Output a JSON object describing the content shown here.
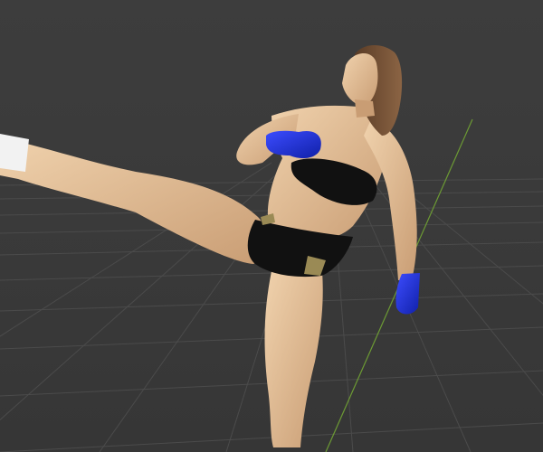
{
  "viewport": {
    "background_color": "#3a3a3a",
    "grid_color": "#4a4a4a",
    "x_axis_color": "#8a3a3a",
    "y_axis_color": "#6c9a34"
  },
  "figure": {
    "subject": "3d-character-model-high-kick-pose",
    "skin_color": "#d9b48f",
    "hair_color": "#6a4a30",
    "outfit_color": "#111111",
    "outfit_accent_color": "#9a8a55",
    "glove_color": "#1f2fd6",
    "sock_color": "#f2f2f2"
  }
}
